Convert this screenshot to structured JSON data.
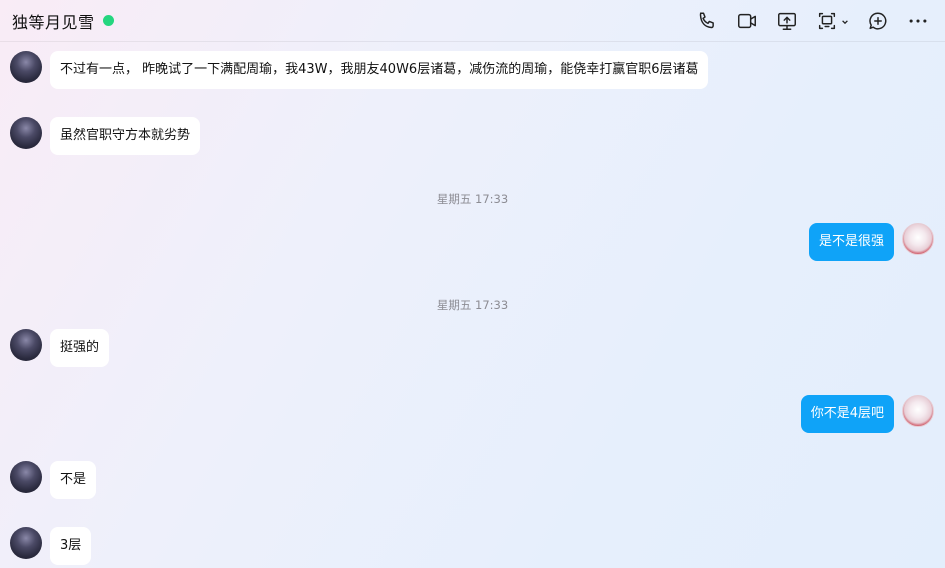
{
  "header": {
    "contact_name": "独等月见雪",
    "status_color": "#24d67f",
    "icons": [
      "phone-icon",
      "video-icon",
      "screen-share-icon",
      "remote-assist-icon",
      "chevron-down-icon",
      "add-member-icon",
      "more-icon"
    ]
  },
  "messages": [
    {
      "side": "left",
      "text": "不过有一点， 昨晚试了一下满配周瑜，我43W，我朋友40W6层诸葛，减伤流的周瑜，能侥幸打赢官职6层诸葛"
    },
    {
      "side": "left",
      "text": "虽然官职守方本就劣势"
    },
    {
      "type": "time",
      "text": "星期五 17:33"
    },
    {
      "side": "right",
      "text": "是不是很强"
    },
    {
      "type": "time",
      "text": "星期五 17:33"
    },
    {
      "side": "left",
      "text": "挺强的"
    },
    {
      "side": "right",
      "text": "你不是4层吧"
    },
    {
      "side": "left",
      "text": "不是"
    },
    {
      "side": "left",
      "text": "3层"
    }
  ],
  "colors": {
    "self_bubble": "#0fa3f8",
    "peer_bubble": "#ffffff",
    "timestamp": "#8c8c93"
  }
}
